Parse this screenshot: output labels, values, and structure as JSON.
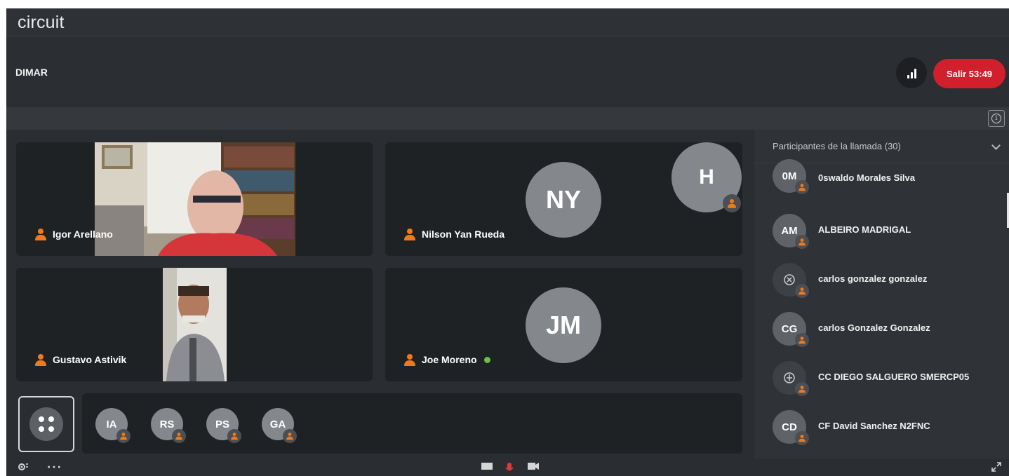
{
  "app": {
    "logo": "circuit"
  },
  "header": {
    "title": "DIMAR",
    "exit_label": "Salir",
    "timer": "53:49"
  },
  "tiles": [
    {
      "name": "Igor Arellano"
    },
    {
      "name": "Nilson Yan Rueda",
      "initials": "NY",
      "secondary_initials": "H"
    },
    {
      "name": "Gustavo Astivik"
    },
    {
      "name": "Joe Moreno",
      "initials": "JM"
    }
  ],
  "strip": {
    "avatars": [
      "IA",
      "RS",
      "PS",
      "GA"
    ]
  },
  "panel": {
    "title": "Participantes de la llamada",
    "count": "(30)",
    "participants": [
      {
        "initials": "0M",
        "name": "0swaldo Morales Silva"
      },
      {
        "initials": "AM",
        "name": "ALBEIRO MADRIGAL"
      },
      {
        "initials": "",
        "name": "carlos gonzalez gonzalez"
      },
      {
        "initials": "CG",
        "name": "carlos Gonzalez Gonzalez"
      },
      {
        "initials": "",
        "name": "CC DIEGO SALGUERO SMERCP05"
      },
      {
        "initials": "CD",
        "name": "CF David Sanchez N2FNC"
      }
    ]
  },
  "colors": {
    "accent_red": "#d11f2c",
    "presence_orange": "#f07a1a",
    "online_green": "#6bc04b"
  },
  "icons": [
    "signal-icon",
    "info-icon",
    "chevron-down-icon",
    "person-icon",
    "grid-view-icon",
    "settings-icon",
    "more-icon",
    "screen-share-icon",
    "microphone-icon",
    "camera-icon",
    "fullscreen-icon"
  ]
}
